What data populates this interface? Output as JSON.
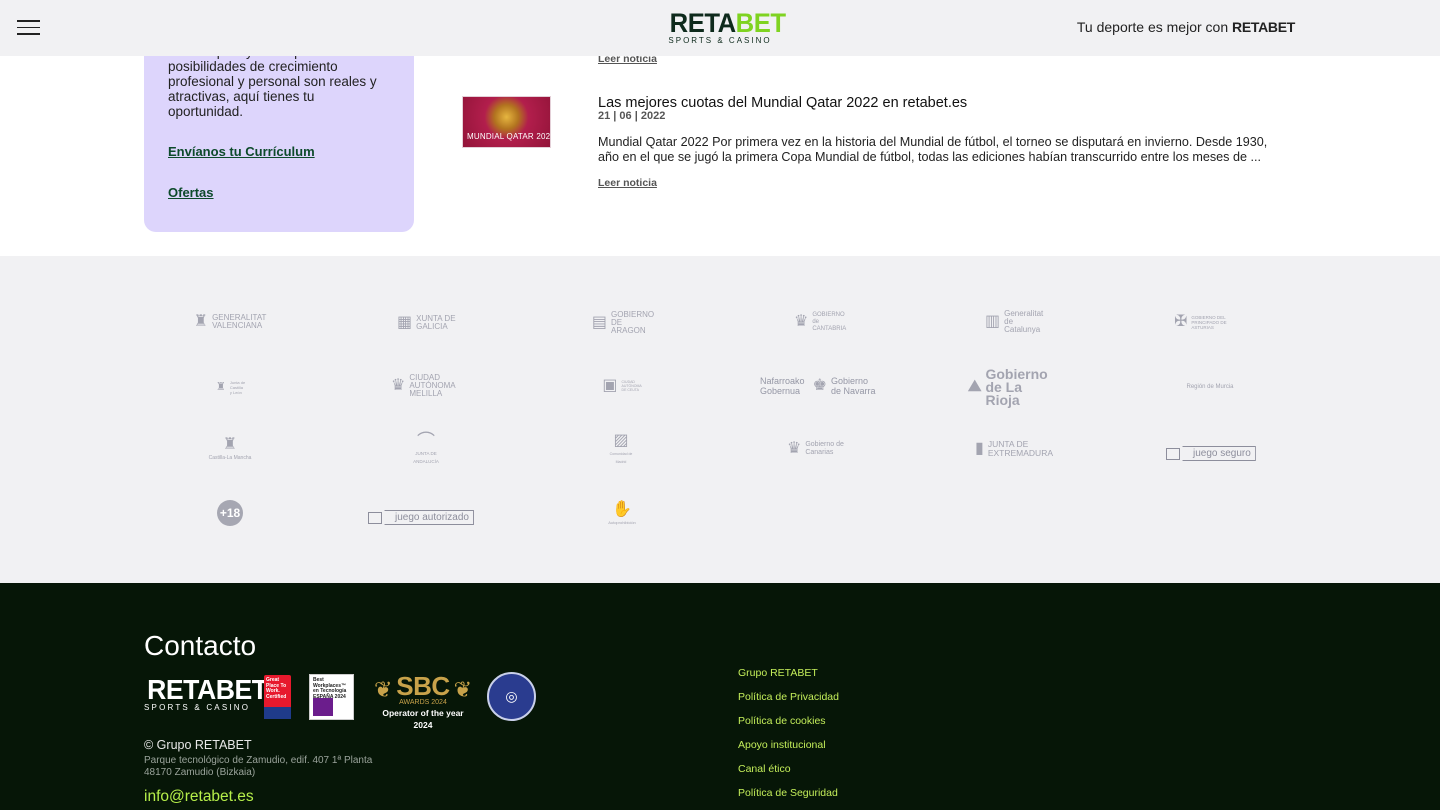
{
  "header": {
    "logo_main": "RETA",
    "logo_accent": "BET",
    "logo_sub": "SPORTS & CASINO",
    "tagline_prefix": "Tu deporte es mejor con",
    "tagline_brand": "RETABET"
  },
  "card": {
    "text": "nuestro país y en el que las posibilidades de crecimiento profesional y personal son reales y atractivas, aquí tienes tu oportunidad.",
    "link_cv": "Envíanos tu Currículum",
    "link_offers": "Ofertas"
  },
  "news": [
    {
      "read_more": "Leer noticia"
    },
    {
      "title": "Las mejores cuotas del Mundial Qatar 2022 en retabet.es",
      "date": "21 | 06 | 2022",
      "thumb_caption": "MUNDIAL QATAR 2022",
      "body": "Mundial Qatar 2022 Por primera vez en la historia del Mundial de fútbol, el torneo se disputará en invierno. Desde 1930, año en el que se jugó la primera Copa Mundial de fútbol, todas las ediciones habían transcurrido entre los meses de ...",
      "read_more": "Leer noticia"
    }
  ],
  "logos": {
    "r1": [
      "GENERALITAT VALENCIANA",
      "XUNTA DE GALICIA",
      "GOBIERNO DE ARAGON",
      "GOBIERNO de CANTABRIA",
      "Generalitat de Catalunya",
      "GOBIERNO DEL PRINCIPADO DE ASTURIAS"
    ],
    "r2": [
      "Junta de Castilla y León",
      "CIUDAD AUTÓNOMA MELILLA",
      "CIUDAD AUTÓNOMA DE CEUTA",
      "Nafarroako Gobernua",
      "Gobierno de Navarra",
      "Gobierno de La Rioja",
      "Región de Murcia"
    ],
    "r3": [
      "Castilla-La Mancha",
      "JUNTA DE ANDALUCÍA",
      "Comunidad de Madrid",
      "Gobierno de Canarias",
      "JUNTA DE EXTREMADURA",
      "juego seguro"
    ],
    "r4": [
      "+18",
      "juego autorizado",
      "Autoprohibición"
    ]
  },
  "footer": {
    "title": "Contacto",
    "logo_main": "RETA",
    "logo_accent": "BET",
    "logo_sub": "SPORTS & CASINO",
    "gptw": "Great Place To Work. Certified",
    "best_workplaces": "Best Workplaces™ en Tecnología ESPAÑA 2024",
    "sbc_main": "SBC",
    "sbc_sub": "AWARDS 2024",
    "sbc_caption": "Operator of the year 2024",
    "copyright": "© Grupo RETABET",
    "address_1": "Parque tecnológico de Zamudio, edif. 407 1ª Planta",
    "address_2": "48170 Zamudio (Bizkaia)",
    "email": "info@retabet.es",
    "links": [
      "Grupo RETABET",
      "Política de Privacidad",
      "Política de cookies",
      "Apoyo institucional",
      "Canal ético",
      "Política de Seguridad"
    ]
  }
}
